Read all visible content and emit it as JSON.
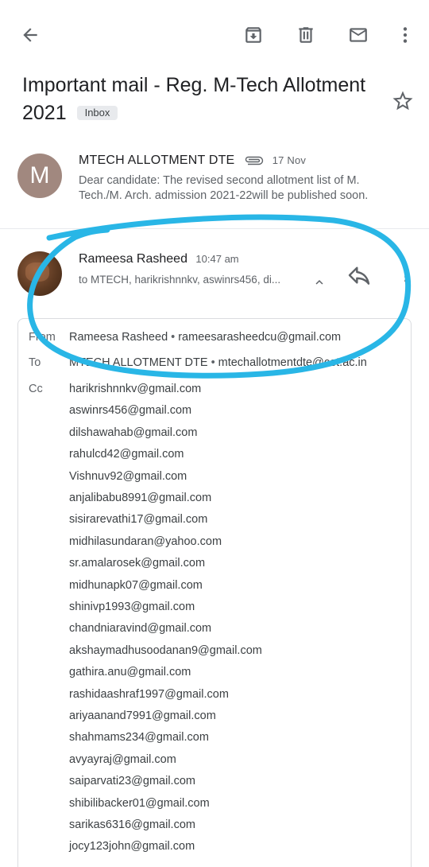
{
  "toolbar": {
    "back_icon": "arrow-back-icon",
    "archive_icon": "archive-icon",
    "delete_icon": "trash-icon",
    "mark_unread_icon": "mail-icon",
    "more_icon": "more-vert-icon"
  },
  "subject": {
    "title": "Important mail - Reg. M-Tech Allotment 2021",
    "label": "Inbox"
  },
  "messages": [
    {
      "avatar_letter": "M",
      "sender": "MTECH ALLOTMENT DTE",
      "date": "17 Nov",
      "snippet": "Dear candidate: The revised second allotment list of M. Tech./M. Arch. admission 2021-22will be published soon."
    },
    {
      "sender": "Rameesa Rasheed",
      "time": "10:47 am",
      "to_summary": "to MTECH, harikrishnnkv, aswinrs456, di..."
    }
  ],
  "details": {
    "from_label": "From",
    "from_name": "Rameesa Rasheed",
    "from_email": "rameesarasheedcu@gmail.com",
    "to_label": "To",
    "to_name": "MTECH ALLOTMENT DTE",
    "to_email": "mtechallotmentdte@cet.ac.in",
    "cc_label": "Cc",
    "cc": [
      "harikrishnnkv@gmail.com",
      "aswinrs456@gmail.com",
      "dilshawahab@gmail.com",
      "rahulcd42@gmail.com",
      "Vishnuv92@gmail.com",
      "anjalibabu8991@gmail.com",
      "sisirarevathi17@gmail.com",
      "midhilasundaran@yahoo.com",
      "sr.amalarosek@gmail.com",
      "midhunapk07@gmail.com",
      "shinivp1993@gmail.com",
      "chandniaravind@gmail.com",
      "akshaymadhusoodanan9@gmail.com",
      "gathira.anu@gmail.com",
      "rashidaashraf1997@gmail.com",
      "ariyaanand7991@gmail.com",
      "shahmams234@gmail.com",
      "avyayraj@gmail.com",
      "saiparvati23@gmail.com",
      "shibilibacker01@gmail.com",
      "sarikas6316@gmail.com",
      "jocy123john@gmail.com"
    ]
  },
  "annotation": {
    "color": "#29b6e6"
  }
}
